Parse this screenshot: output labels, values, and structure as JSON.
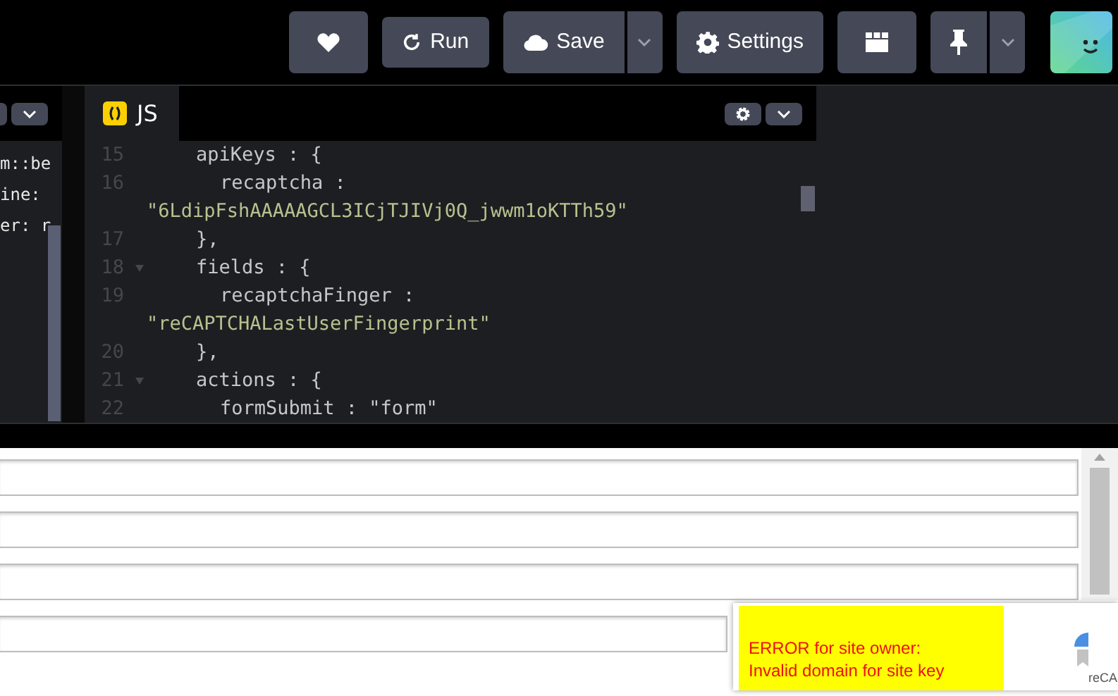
{
  "toolbar": {
    "buttons": [
      {
        "kind": "heart"
      },
      {
        "kind": "run",
        "label": "Run"
      },
      {
        "kind": "save",
        "label": "Save",
        "dropdown": true
      },
      {
        "kind": "settings",
        "label": "Settings"
      },
      {
        "kind": "layout"
      },
      {
        "kind": "pin",
        "dropdown": true
      },
      {
        "kind": "avatar"
      }
    ]
  },
  "css_panel": {
    "fragments": [
      "m::be",
      "ine:",
      "er: r"
    ]
  },
  "js_panel": {
    "tab": {
      "label": "JS",
      "selected": true
    },
    "lines": [
      {
        "number": "15",
        "text": "apiKeys : {",
        "foldable": false
      },
      {
        "number": "16",
        "text": "recaptcha :",
        "indent": true,
        "wrap": "\"6LdipFshAAAAAGCL3ICjTJIVj0Q_jwwm1oKTTh59\"",
        "foldable": false
      },
      {
        "number": "17",
        "text": "},",
        "foldable": false
      },
      {
        "number": "18",
        "text": "fields : {",
        "foldable": true
      },
      {
        "number": "19",
        "text": "recaptchaFinger :",
        "indent": true,
        "wrap": "\"reCAPTCHALastUserFingerprint\"",
        "foldable": false
      },
      {
        "number": "20",
        "text": "},",
        "foldable": false
      },
      {
        "number": "21",
        "text": "actions : {",
        "foldable": true
      },
      {
        "number": "22",
        "text": "formSubmit : \"form\"",
        "indent": true,
        "foldable": false
      }
    ]
  },
  "preview": {
    "field_count_rows": [
      {},
      {},
      {},
      {}
    ],
    "recaptcha": {
      "error_lines": [
        "ERROR for site owner:",
        "Invalid domain for site key"
      ],
      "brand": "reCA"
    }
  }
}
